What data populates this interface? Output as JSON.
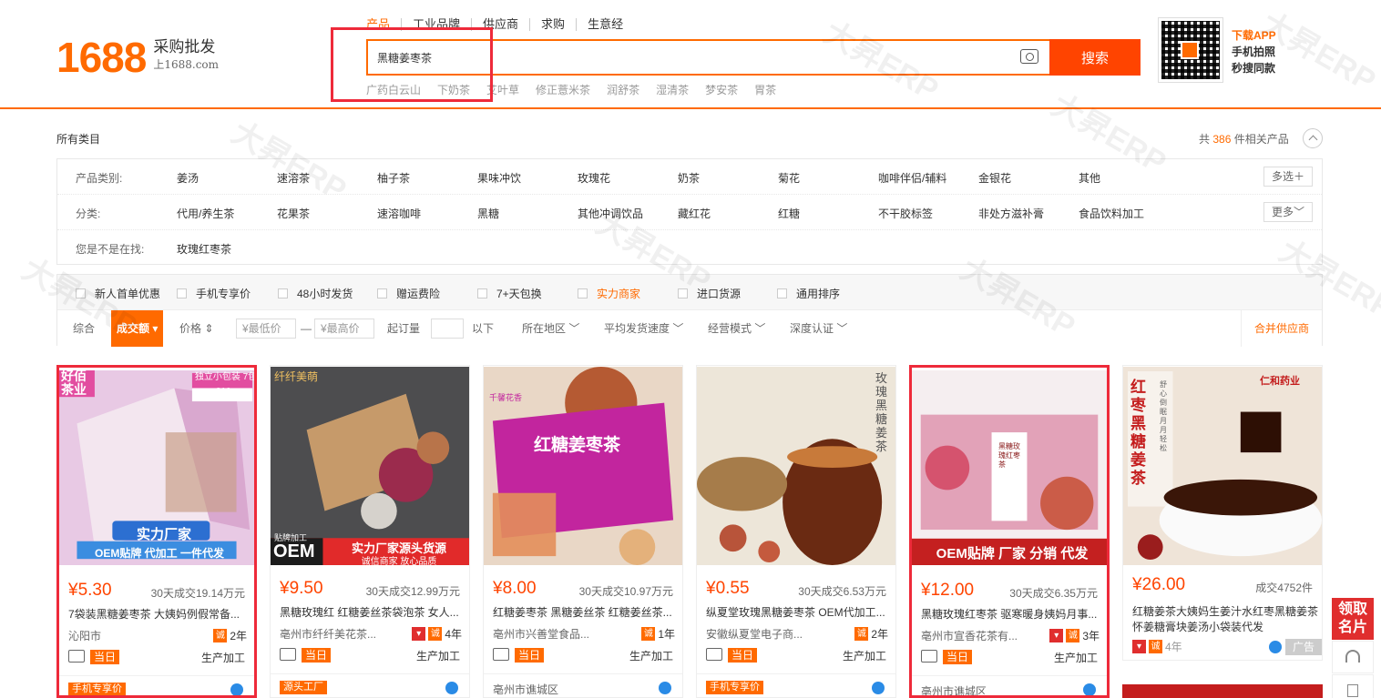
{
  "header": {
    "logo_num": "1688",
    "logo_sub1": "采购批发",
    "logo_sub2": "上1688.com",
    "tabs": [
      "产品",
      "工业品牌",
      "供应商",
      "求购",
      "生意经"
    ],
    "search_value": "黑糖姜枣茶",
    "search_button": "搜索",
    "hot_words": [
      "广药白云山",
      "下奶茶",
      "艾叶草",
      "修正薏米茶",
      "润舒茶",
      "湿清茶",
      "梦安茶",
      "胃茶"
    ],
    "app_lines": [
      "下载APP",
      "手机拍照",
      "秒搜同款"
    ]
  },
  "category": {
    "breadcrumb": "所有类目",
    "count_prefix": "共",
    "count": "386",
    "count_suffix": "件相关产品",
    "rows": [
      {
        "label": "产品类别:",
        "items": [
          "姜汤",
          "速溶茶",
          "柚子茶",
          "果味冲饮",
          "玫瑰花",
          "奶茶",
          "菊花",
          "咖啡伴侣/辅料",
          "金银花",
          "其他"
        ],
        "more": "多选＋"
      },
      {
        "label": "分类:",
        "items": [
          "代用/养生茶",
          "花果茶",
          "速溶咖啡",
          "黑糖",
          "其他冲调饮品",
          "藏红花",
          "红糖",
          "不干胶标签",
          "非处方滋补膏",
          "食品饮料加工"
        ],
        "more": "更多﹀"
      },
      {
        "label": "您是不是在找:",
        "items": [
          "玫瑰红枣茶"
        ],
        "more": ""
      }
    ]
  },
  "filters": {
    "checks": [
      "新人首单优惠",
      "手机专享价",
      "48小时发货",
      "赠运费险",
      "7+天包换",
      "实力商家",
      "进口货源",
      "通用排序"
    ],
    "sort": {
      "comprehensive": "综合",
      "active": "成交额",
      "price": "价格",
      "min_price": "¥最低价",
      "dash": "—",
      "max_price": "¥最高价",
      "moq": "起订量",
      "below": "以下",
      "region": "所在地区",
      "ship_speed": "平均发货速度",
      "biz_mode": "经营模式",
      "cert": "深度认证",
      "merge": "合并供应商"
    }
  },
  "products": [
    {
      "price": "¥5.30",
      "sales": "30天成交19.14万元",
      "title": "7袋装黑糖姜枣茶 大姨妈例假常备...",
      "seller": "沁阳市",
      "years": "2年",
      "today": "当日",
      "mode": "生产加工",
      "bottom": "手机专享价",
      "img_text1": "实力厂家",
      "img_text2": "OEM贴牌 代加工 一件代发",
      "img_corner": "独立小包装 7包210g",
      "img_corner2": "好佰茶业"
    },
    {
      "price": "¥9.50",
      "sales": "30天成交12.99万元",
      "title": "黑糖玫瑰红 红糖姜丝茶袋泡茶 女人...",
      "seller": "亳州市纤纤美花茶...",
      "years": "4年",
      "today": "当日",
      "mode": "生产加工",
      "bottom": "源头工厂",
      "img_text1": "OEM",
      "img_text2": "实力厂家源头货源",
      "img_text3": "诚信商家 放心品质",
      "img_corner": "纤纤美萌",
      "img_corner2": "贴牌加工"
    },
    {
      "price": "¥8.00",
      "sales": "30天成交10.97万元",
      "title": "红糖姜枣茶 黑糖姜丝茶 红糖姜丝茶...",
      "seller": "亳州市兴善堂食品...",
      "years": "1年",
      "today": "当日",
      "mode": "生产加工",
      "bottom": "亳州市谯城区",
      "img_text1": "红糖姜枣茶",
      "img_corner": "千馨花香"
    },
    {
      "price": "¥0.55",
      "sales": "30天成交6.53万元",
      "title": "纵夏堂玫瑰黑糖姜枣茶 OEM代加工...",
      "seller": "安徽纵夏堂电子商...",
      "years": "2年",
      "today": "当日",
      "mode": "生产加工",
      "bottom": "手机专享价",
      "img_text1": "玫瑰黑糖姜茶"
    },
    {
      "price": "¥12.00",
      "sales": "30天成交6.35万元",
      "title": "黑糖玫瑰红枣茶 驱寒暖身姨妈月事...",
      "seller": "亳州市宣香花茶有...",
      "years": "3年",
      "today": "当日",
      "mode": "生产加工",
      "bottom": "亳州市谯城区",
      "img_text1": "OEM贴牌 厂家 分销 代发",
      "img_text2": "黑糖玫瑰红枣茶"
    },
    {
      "price": "¥26.00",
      "sales": "成交4752件",
      "title": "红糖姜茶大姨妈生姜汁水红枣黑糖姜茶怀姜糖膏块姜汤小袋装代发",
      "seller": "",
      "years": "4年",
      "today": "",
      "mode": "",
      "bottom": "",
      "img_text1": "红枣黑糖姜茶",
      "img_text2": "舒心倒眠 月月轻松",
      "img_corner": "仁和药业",
      "ad": "广告"
    }
  ],
  "side": {
    "card": "领取名片"
  },
  "watermark": "大昇ERP"
}
